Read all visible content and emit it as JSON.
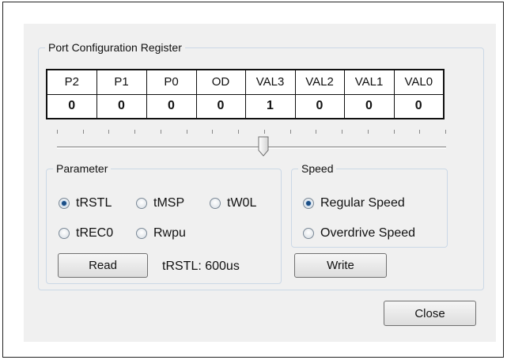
{
  "port_group": {
    "title": "Port Configuration Register",
    "headers": [
      "P2",
      "P1",
      "P0",
      "OD",
      "VAL3",
      "VAL2",
      "VAL1",
      "VAL0"
    ],
    "values": [
      "0",
      "0",
      "0",
      "0",
      "1",
      "0",
      "0",
      "0"
    ],
    "slider_position_index": 4
  },
  "parameter_group": {
    "title": "Parameter",
    "options": [
      "tRSTL",
      "tMSP",
      "tW0L",
      "tREC0",
      "Rwpu"
    ],
    "selected": "tRSTL",
    "read_label": "Read",
    "readout": "tRSTL: 600us"
  },
  "speed_group": {
    "title": "Speed",
    "options": [
      "Regular Speed",
      "Overdrive Speed"
    ],
    "selected": "Regular Speed",
    "write_label": "Write"
  },
  "close_label": "Close"
}
